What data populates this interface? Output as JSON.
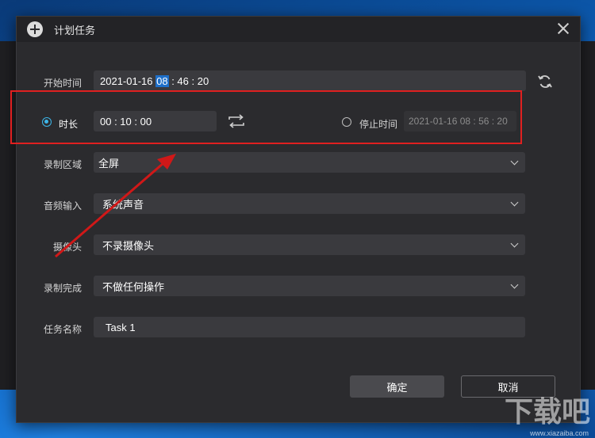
{
  "dialog": {
    "title": "计划任务"
  },
  "form": {
    "start_time": {
      "label": "开始时间",
      "value_prefix": "2021-01-16 ",
      "value_highlight": "08",
      "value_suffix": " : 46 : 20"
    },
    "duration": {
      "label": "时长",
      "value": "00 : 10 : 00",
      "selected": true
    },
    "stop_time": {
      "label": "停止时间",
      "value": "2021-01-16 08 : 56 : 20",
      "selected": false
    },
    "record_area": {
      "label": "录制区域",
      "value": "全屏"
    },
    "audio_input": {
      "label": "音频输入",
      "value": "系统声音"
    },
    "camera": {
      "label": "摄像头",
      "value": "不录摄像头"
    },
    "on_complete": {
      "label": "录制完成",
      "value": "不做任何操作"
    },
    "task_name": {
      "label": "任务名称",
      "value": "Task 1"
    }
  },
  "buttons": {
    "ok": "确定",
    "cancel": "取消"
  },
  "watermark": {
    "logo": "下载吧",
    "url": "www.xiazaiba.com"
  },
  "icons": {
    "title": "add-circle-icon",
    "close": "close-icon",
    "refresh": "refresh-icon",
    "swap": "swap-icon"
  },
  "colors": {
    "accent": "#3db6e8",
    "highlight": "#e02020",
    "dialog_bg": "#2b2b2e",
    "field_bg": "#3a3a3e"
  }
}
